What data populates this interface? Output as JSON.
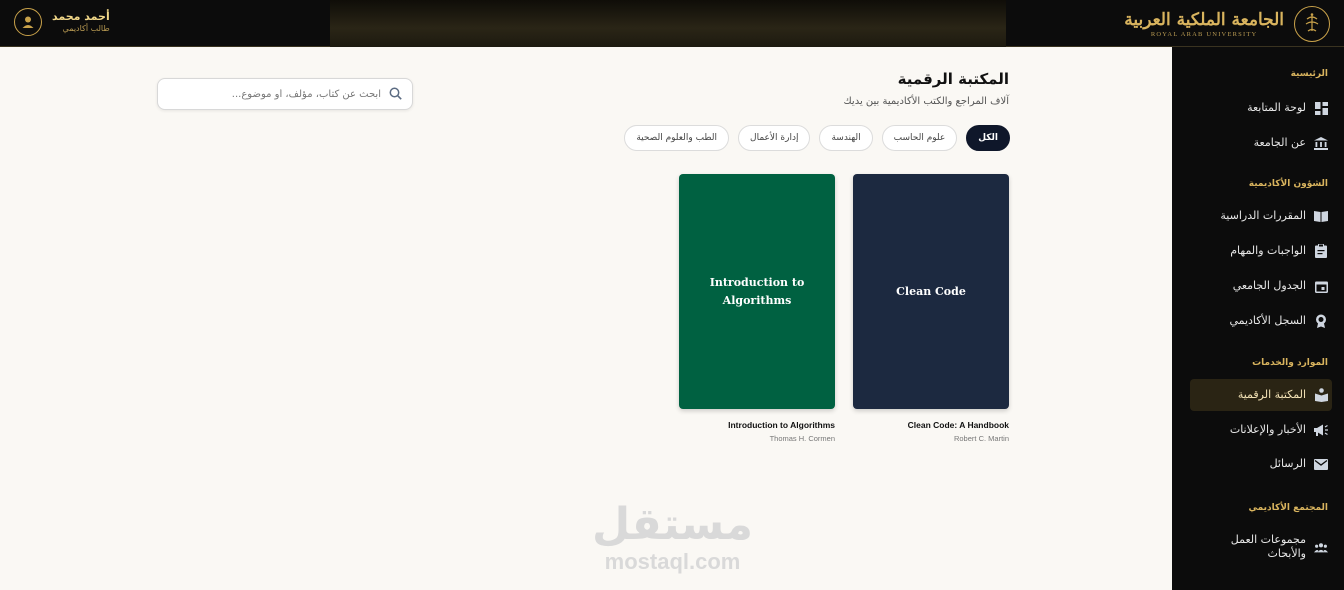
{
  "header": {
    "university_name": "الجامعة الملكية العربية",
    "university_name_en": "ROYAL ARAB UNIVERSITY",
    "user_name": "أحمد محمد",
    "user_role": "طالب أكاديمي"
  },
  "sidebar": {
    "sections": [
      {
        "title": "الرئيسية",
        "items": [
          {
            "label": "لوحة المتابعة",
            "icon": "dashboard-icon"
          },
          {
            "label": "عن الجامعة",
            "icon": "institution-icon"
          }
        ]
      },
      {
        "title": "الشؤون الأكاديمية",
        "items": [
          {
            "label": "المقررات الدراسية",
            "icon": "book-open-icon"
          },
          {
            "label": "الواجبات والمهام",
            "icon": "clipboard-icon"
          },
          {
            "label": "الجدول الجامعي",
            "icon": "calendar-icon"
          },
          {
            "label": "السجل الأكاديمي",
            "icon": "award-icon"
          }
        ]
      },
      {
        "title": "الموارد والخدمات",
        "items": [
          {
            "label": "المكتبة الرقمية",
            "icon": "library-icon",
            "active": true
          },
          {
            "label": "الأخبار والإعلانات",
            "icon": "megaphone-icon"
          },
          {
            "label": "الرسائل",
            "icon": "envelope-icon"
          }
        ]
      },
      {
        "title": "المجتمع الأكاديمي",
        "items": [
          {
            "label": "مجموعات العمل والأبحاث",
            "icon": "users-icon"
          }
        ]
      }
    ]
  },
  "main": {
    "title": "المكتبة الرقمية",
    "subtitle": "آلاف المراجع والكتب الأكاديمية بين يديك",
    "search_placeholder": "ابحث عن كتاب، مؤلف، أو موضوع...",
    "filters": [
      {
        "label": "الكل",
        "active": true
      },
      {
        "label": "علوم الحاسب"
      },
      {
        "label": "الهندسة"
      },
      {
        "label": "إدارة الأعمال"
      },
      {
        "label": "الطب والعلوم الصحية"
      }
    ],
    "books": [
      {
        "cover_text": "Clean Code",
        "title": "Clean Code: A Handbook",
        "author": "Robert C. Martin",
        "color": "#1c2940"
      },
      {
        "cover_text": "Introduction to Algorithms",
        "title": "Introduction to Algorithms",
        "author": "Thomas H. Cormen",
        "color": "#006141"
      }
    ]
  },
  "watermark": {
    "arabic": "مستقل",
    "latin": "mostaql.com"
  },
  "colors": {
    "accent_gold": "#d9b45e",
    "sidebar_bg": "#0c0c0c",
    "chip_active": "#0f172a"
  }
}
